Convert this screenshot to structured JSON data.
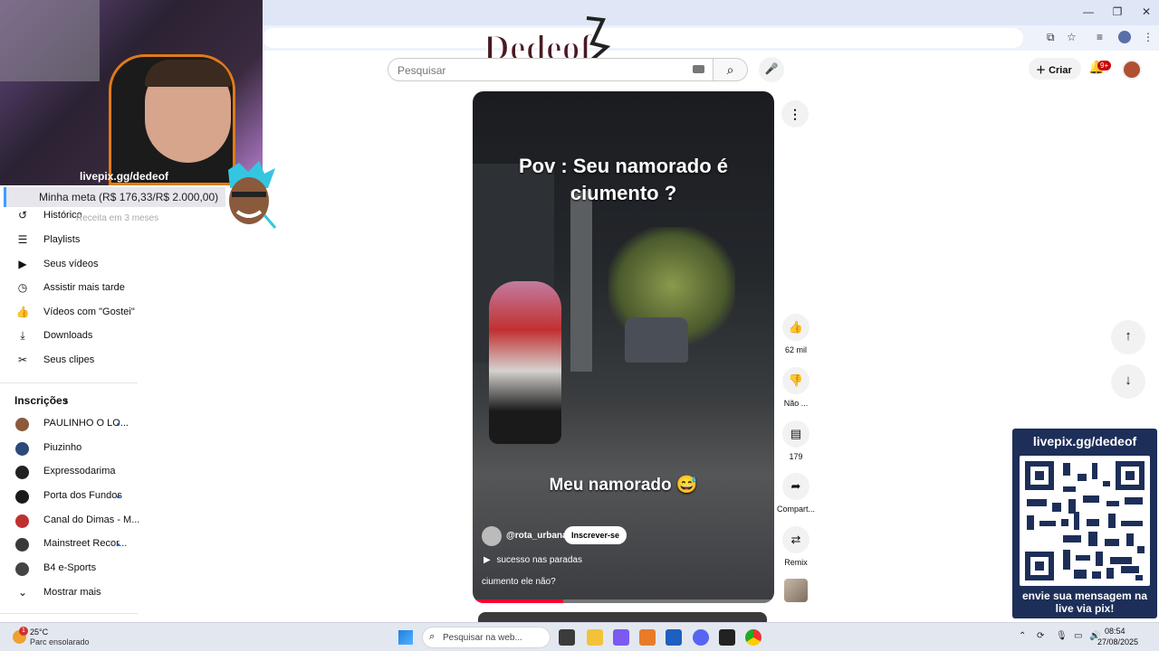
{
  "window": {
    "minimize_glyph": "—",
    "restore_glyph": "❐",
    "close_glyph": "✕"
  },
  "overlay": {
    "webcam_caption": "livepix.gg/dedeof",
    "goal_text": "Minha meta (R$ 176,33/R$ 2.000,00)",
    "logo_text": "Dedeof"
  },
  "header": {
    "search_placeholder": "Pesquisar",
    "create_label": "Criar",
    "notifications_badge": "9+"
  },
  "sidebar": {
    "ghost_text": "Receita em 3 meses",
    "items": [
      {
        "label": "Histórico",
        "icon": "history-icon",
        "glyph": "↺"
      },
      {
        "label": "Playlists",
        "icon": "playlists-icon",
        "glyph": "☰"
      },
      {
        "label": "Seus vídeos",
        "icon": "your-videos-icon",
        "glyph": "▶"
      },
      {
        "label": "Assistir mais tarde",
        "icon": "watch-later-icon",
        "glyph": "◷"
      },
      {
        "label": "Vídeos com \"Gostei\"",
        "icon": "thumbs-up-icon",
        "glyph": "👍"
      },
      {
        "label": "Downloads",
        "icon": "download-icon",
        "glyph": "⤓"
      },
      {
        "label": "Seus clipes",
        "icon": "scissors-icon",
        "glyph": "✂"
      }
    ],
    "subscriptions_title": "Inscrições",
    "subscriptions": [
      {
        "label": "PAULINHO O LO...",
        "color": "#8a5a3a",
        "new": true
      },
      {
        "label": "Piuzinho",
        "color": "#2b4a7a",
        "new": false
      },
      {
        "label": "Expressodarima",
        "color": "#222222",
        "new": false
      },
      {
        "label": "Porta dos Fundos",
        "color": "#1a1a1a",
        "new": true
      },
      {
        "label": "Canal do Dimas - M...",
        "color": "#c03030",
        "new": false
      },
      {
        "label": "Mainstreet Recor...",
        "color": "#3a3a3a",
        "new": true
      },
      {
        "label": "B4 e-Sports",
        "color": "#444444",
        "new": false
      }
    ],
    "show_more": "Mostrar mais"
  },
  "short": {
    "title_line1": "Pov : Seu namorado é",
    "title_line2": "ciumento ?",
    "subtitle": "Meu namorado 😅",
    "channel": "@rota_urbana",
    "subscribe_label": "Inscrever-se",
    "music": "sucesso nas paradas",
    "description": "ciumento ele não?",
    "progress_fraction": 0.3
  },
  "actions": {
    "likes": "62 mil",
    "dislike_label": "Não ...",
    "comments": "179",
    "share_label": "Compart...",
    "remix_label": "Remix"
  },
  "pix": {
    "url": "livepix.gg/dedeof",
    "message_line1": "envie sua mensagem na",
    "message_line2": "live via pix!"
  },
  "taskbar": {
    "weather_badge": "1",
    "temperature": "25°C",
    "weather_desc": "Parc ensolarado",
    "search_placeholder": "Pesquisar na web...",
    "time": "08:54",
    "date": "27/08/2025"
  },
  "colors": {
    "youtube_red": "#ff0033",
    "pix_navy": "#1d2f58",
    "link_blue": "#065fd4"
  }
}
